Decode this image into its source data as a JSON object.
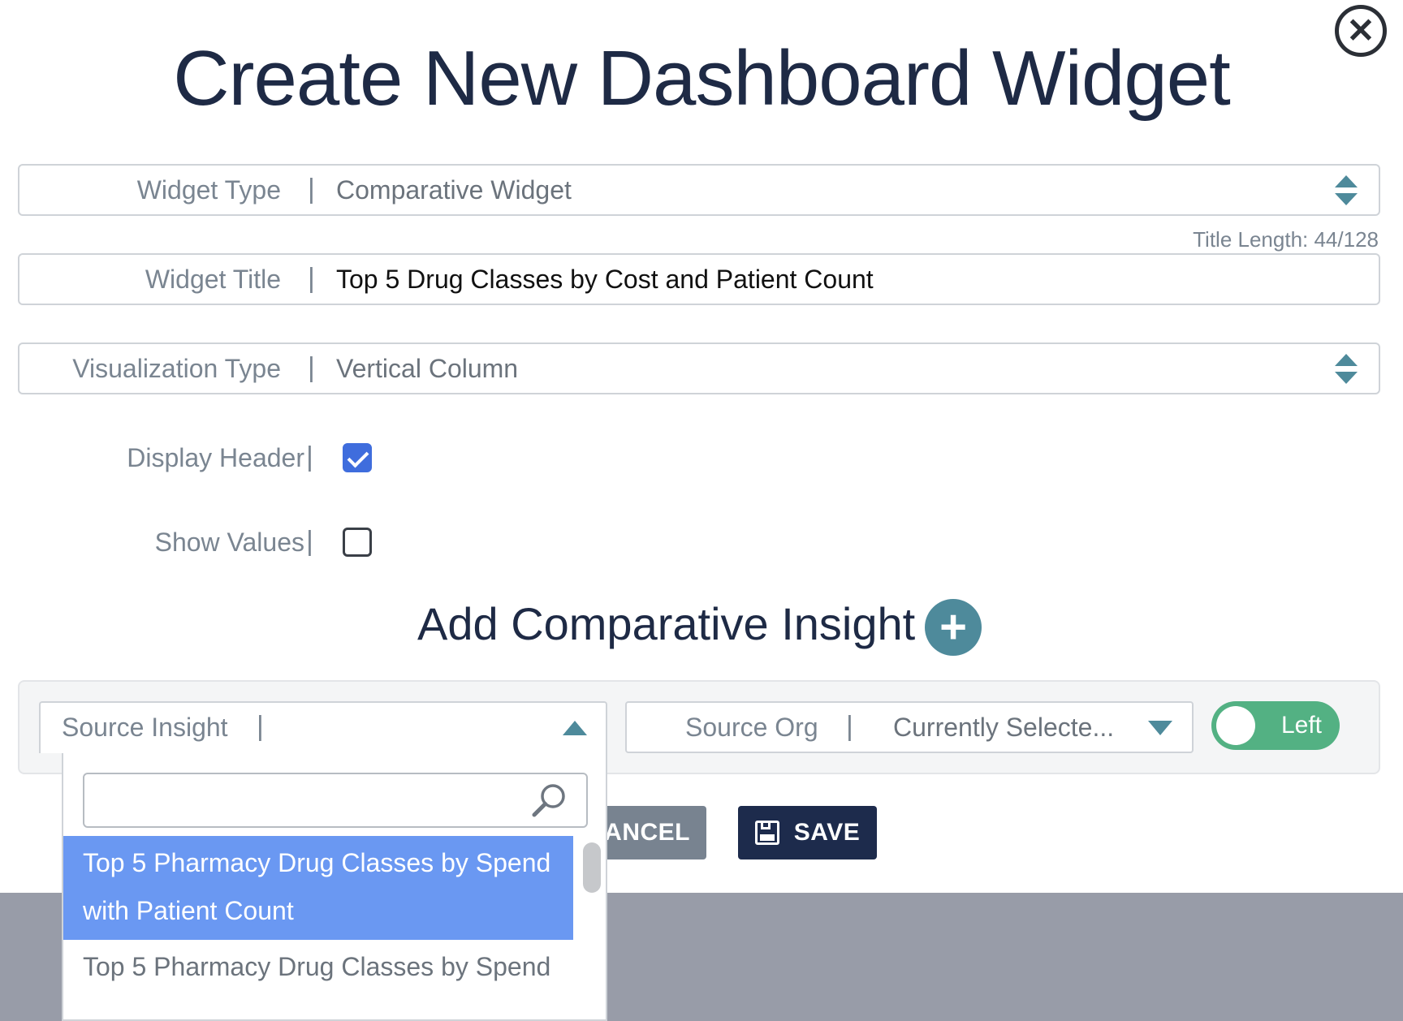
{
  "dialog": {
    "title": "Create New Dashboard Widget",
    "close_icon": "close-icon"
  },
  "fields": {
    "widget_type": {
      "label": "Widget Type",
      "value": "Comparative Widget"
    },
    "title_length": "Title Length: 44/128",
    "widget_title": {
      "label": "Widget Title",
      "value": "Top 5 Drug Classes by Cost and Patient Count"
    },
    "visualization_type": {
      "label": "Visualization Type",
      "value": "Vertical Column"
    },
    "display_header": {
      "label": "Display Header",
      "checked": true
    },
    "show_values": {
      "label": "Show Values",
      "checked": false
    },
    "separator": "|"
  },
  "comparative": {
    "title": "Add Comparative Insight",
    "add_icon": "plus-icon",
    "source_insight": {
      "label": "Source Insight",
      "value": ""
    },
    "source_org": {
      "label": "Source Org",
      "value": "Currently Selecte..."
    },
    "toggle": {
      "label": "Left",
      "on": true
    },
    "dropdown": {
      "search_value": "",
      "search_icon": "search-icon",
      "options": [
        {
          "label": "Top 5 Pharmacy Drug Classes by Spend with Patient Count",
          "selected": true
        },
        {
          "label": "Top 5 Pharmacy Drug Classes by Spend",
          "selected": false
        }
      ]
    }
  },
  "actions": {
    "cancel_label": "ANCEL",
    "save_label": "SAVE"
  },
  "colors": {
    "accent": "#4e8a9b",
    "selected": "#6a98f2",
    "toggle_on": "#53b183",
    "save": "#1d2b4c",
    "cancel": "#788390"
  }
}
